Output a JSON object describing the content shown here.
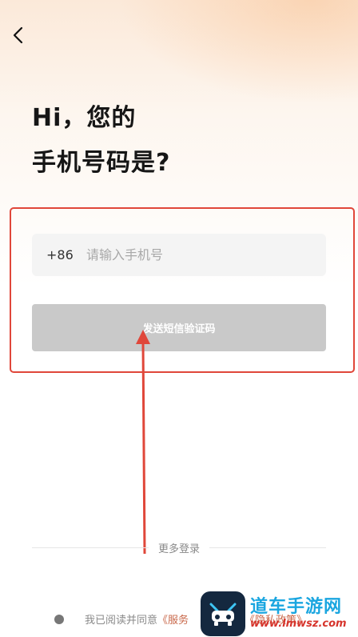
{
  "header": {
    "back_icon": "chevron-left-icon"
  },
  "title": {
    "line1": "Hi，您的",
    "line2": "手机号码是?"
  },
  "phone": {
    "country_code": "+86",
    "placeholder": "请输入手机号",
    "value": ""
  },
  "actions": {
    "send_code_label": "发送短信验证码"
  },
  "more_login": {
    "label": "更多登录"
  },
  "agreement": {
    "prefix": "我已阅读并同意",
    "service_link": "《服务",
    "privacy_link": "《隐私政策》"
  },
  "watermark": {
    "name": "道车手游网",
    "url": "www.lmwsz.com"
  },
  "colors": {
    "accent_link": "#c9694b",
    "annotation_red": "#e0473a",
    "button_disabled": "#c9c9c9"
  }
}
